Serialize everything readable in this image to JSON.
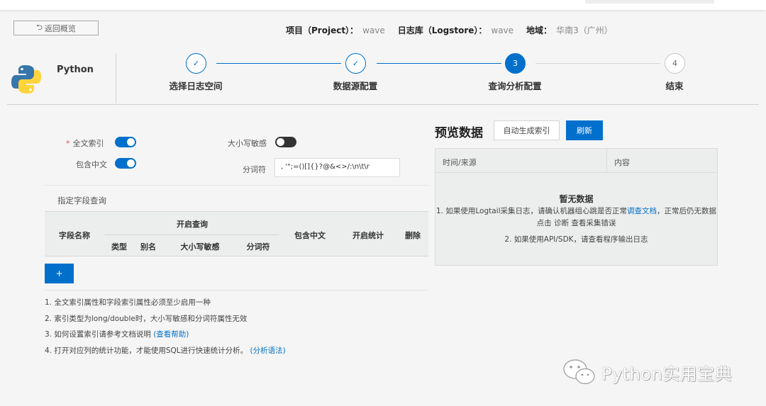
{
  "header": {
    "back_label": "返回概览",
    "project_key": "项目（Project）：",
    "project_value": "wave",
    "logstore_key": "日志库（Logstore）：",
    "logstore_value": "wave",
    "region_key": "地域：",
    "region_value": "华南3（广州）"
  },
  "source": {
    "name": "Python"
  },
  "steps": [
    {
      "label": "选择日志空间",
      "state": "done",
      "mark": "✓"
    },
    {
      "label": "数据源配置",
      "state": "done",
      "mark": "✓"
    },
    {
      "label": "查询分析配置",
      "state": "active",
      "mark": "3"
    },
    {
      "label": "结束",
      "state": "todo",
      "mark": "4"
    }
  ],
  "form": {
    "fulltext_label": "全文索引",
    "fulltext_on": true,
    "chinese_label": "包含中文",
    "chinese_on": true,
    "case_label": "大小写敏感",
    "case_on": false,
    "tokenizer_label": "分词符",
    "tokenizer_value": ", '\";=()[]{}?@&<>/:\\n\\t\\r"
  },
  "field_table": {
    "title": "指定字段查询",
    "col_field": "字段名称",
    "group_enable": "开启查询",
    "col_type": "类型",
    "col_alias": "别名",
    "col_case": "大小写敏感",
    "col_token": "分词符",
    "col_chinese": "包含中文",
    "col_stats": "开启统计",
    "col_delete": "删除",
    "add_label": "+"
  },
  "notes": {
    "n1": "1. 全文索引属性和字段索引属性必须至少启用一种",
    "n2": "2. 索引类型为long/double时，大小写敏感和分词符属性无效",
    "n3": "3. 如何设置索引请参考文档说明",
    "n3_link": "(查看帮助)",
    "n4": "4. 打开对应列的统计功能，才能使用SQL进行快速统计分析。",
    "n4_link": "(分析语法)"
  },
  "preview": {
    "title": "预览数据",
    "auto_btn": "自动生成索引",
    "refresh_btn": "刷新",
    "col_time": "时间/来源",
    "col_content": "内容",
    "empty_title": "暂无数据",
    "line1_a": "1. 如果使用Logtail采集日志，请确认机器组心跳是否正常",
    "line1_link": "调查文档",
    "line1_b": "，正常后仍无数据",
    "line2": "点击 诊断 查看采集错误",
    "line3": "2. 如果使用API/SDK，请查看程序输出日志"
  },
  "watermark": {
    "text": "Python实用宝典"
  },
  "colors": {
    "accent": "#0070cc",
    "required": "#e84c3d"
  }
}
